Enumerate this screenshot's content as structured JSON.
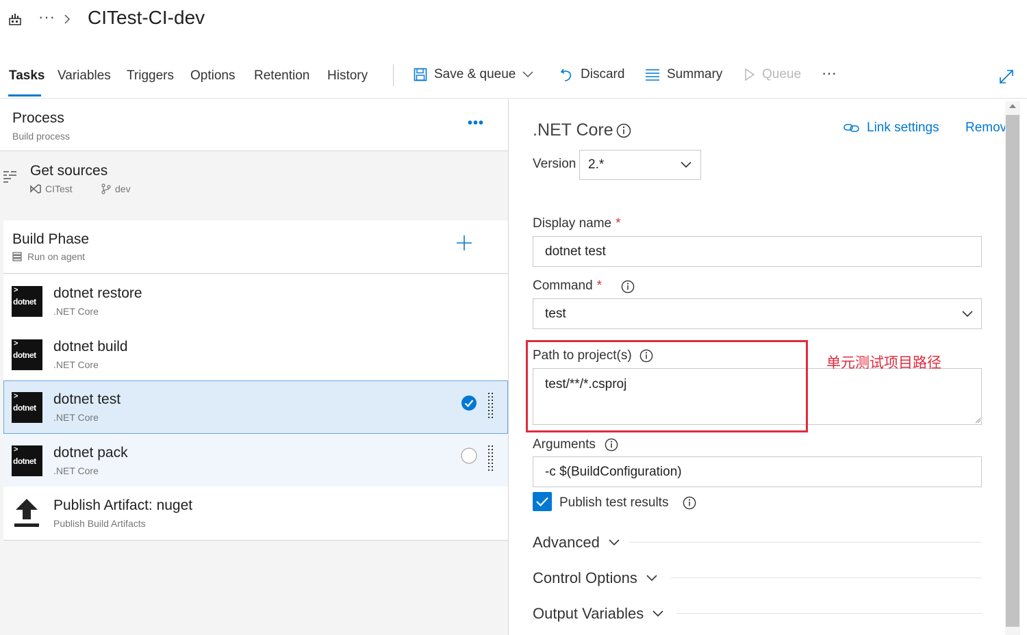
{
  "header": {
    "breadcrumb_more": "···",
    "title": "CITest-CI-dev"
  },
  "tabs": [
    {
      "label": "Tasks",
      "active": true
    },
    {
      "label": "Variables"
    },
    {
      "label": "Triggers"
    },
    {
      "label": "Options"
    },
    {
      "label": "Retention"
    },
    {
      "label": "History"
    }
  ],
  "toolbar": {
    "save_queue": "Save & queue",
    "discard": "Discard",
    "summary": "Summary",
    "queue": "Queue",
    "more": "···"
  },
  "process": {
    "title": "Process",
    "subtitle": "Build process",
    "more": "•••"
  },
  "get_sources": {
    "title": "Get sources",
    "repo": "CITest",
    "branch": "dev"
  },
  "build_phase": {
    "title": "Build Phase",
    "subtitle": "Run on agent"
  },
  "tasks": [
    {
      "name": "dotnet restore",
      "type": ".NET Core",
      "logo": "dotnet"
    },
    {
      "name": "dotnet build",
      "type": ".NET Core",
      "logo": "dotnet"
    },
    {
      "name": "dotnet test",
      "type": ".NET Core",
      "logo": "dotnet"
    },
    {
      "name": "dotnet pack",
      "type": ".NET Core",
      "logo": "dotnet"
    },
    {
      "name": "Publish Artifact: nuget",
      "type": "Publish Build Artifacts"
    }
  ],
  "details": {
    "task_title": ".NET Core",
    "link_settings": "Link settings",
    "remove": "Remove",
    "version_label": "Version",
    "version_value": "2.*",
    "display_name_label": "Display name",
    "required_mark": "*",
    "display_name_value": "dotnet test",
    "command_label": "Command",
    "command_value": "test",
    "path_label": "Path to project(s)",
    "path_value": "test/**/*.csproj",
    "arguments_label": "Arguments",
    "arguments_value": "-c $(BuildConfiguration)",
    "publish_label": "Publish test results",
    "publish_checked": true,
    "sections": [
      "Advanced",
      "Control Options",
      "Output Variables"
    ]
  },
  "annotation": {
    "text": "单元测试项目路径",
    "color": "#e02b3d"
  },
  "colors": {
    "accent": "#0078d4",
    "selected_row": "#deecf9"
  }
}
